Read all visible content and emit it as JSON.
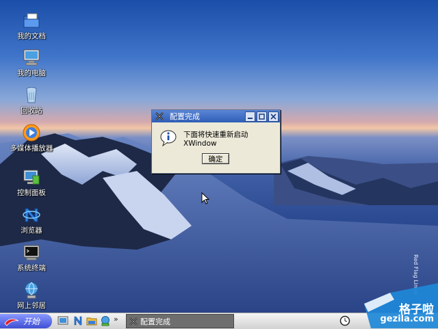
{
  "desktop": {
    "icons": [
      {
        "label": "我的文档",
        "icon": "documents-folder-icon"
      },
      {
        "label": "我的电脑",
        "icon": "computer-icon"
      },
      {
        "label": "回收站",
        "icon": "recycle-bin-icon"
      },
      {
        "label": "多媒体播放器",
        "icon": "media-player-icon"
      },
      {
        "label": "控制面板",
        "icon": "control-panel-icon"
      },
      {
        "label": "浏览器",
        "icon": "browser-icon"
      },
      {
        "label": "系统终端",
        "icon": "terminal-icon"
      },
      {
        "label": "网上邻居",
        "icon": "network-icon"
      }
    ],
    "side_watermark": "Red Flag Linux"
  },
  "dialog": {
    "title": "配置完成",
    "message": "下面将快速重新启动XWindow",
    "ok_label": "确定"
  },
  "taskbar": {
    "start_label": "开始",
    "quick_launch": [
      "show-desktop-icon",
      "browser-icon",
      "file-manager-icon",
      "network-icon"
    ],
    "more_label": "»",
    "task_item_label": "配置完成"
  },
  "watermark": {
    "main": "格子啦",
    "sub": "gezila.com"
  },
  "colors": {
    "titlebar": "#2f5db6",
    "dialog_bg": "#ece9d8",
    "start_button": "#3e4fd4"
  }
}
